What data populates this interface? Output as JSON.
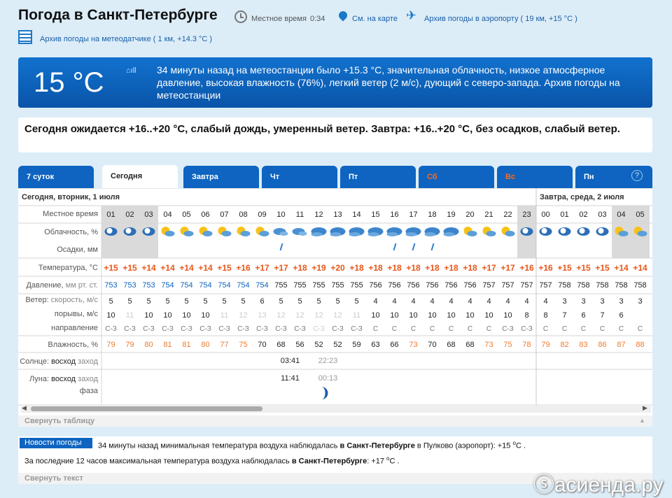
{
  "header": {
    "title": "Погода в Санкт-Петербурге",
    "local_time_label": "Местное время",
    "local_time": "0:34",
    "map_link": "См. на карте",
    "airport_link": "Архив погоды в аэропорту ( 19 км, +15 °C )",
    "station_link": "Архив погоды на метеодатчике ( 1 км, +14.3 °C )"
  },
  "now": {
    "temp": "15 °C",
    "text": "34 минуты назад на метеостанции было +15.3 °C, значительная облачность, низкое атмосферное давление, высокая влажность (76%), легкий ветер (2 м/с), дующий с северо-запада. Архив погоды на метеостанции"
  },
  "forecast": {
    "text": "Сегодня ожидается +16..+20 °C, слабый дождь, умеренный ветер. Завтра: +16..+20 °C, без осадков, слабый ветер."
  },
  "tabs": [
    {
      "label": "7 суток",
      "weekend": false,
      "active": false
    },
    {
      "label": "Сегодня",
      "weekend": false,
      "active": true
    },
    {
      "label": "Завтра",
      "weekend": false,
      "active": false
    },
    {
      "label": "Чт",
      "weekend": false,
      "active": false
    },
    {
      "label": "Пт",
      "weekend": false,
      "active": false
    },
    {
      "label": "Сб",
      "weekend": true,
      "active": false
    },
    {
      "label": "Вс",
      "weekend": true,
      "active": false
    },
    {
      "label": "Пн",
      "weekend": false,
      "active": false
    }
  ],
  "help": "?",
  "table": {
    "day1": "Сегодня, вторник, 1 июля",
    "day2": "Завтра, среда, 2 июля",
    "labels": {
      "time": "Местное время",
      "cloud": "Облачность, %",
      "precip": "Осадки, мм",
      "temp_a": "Температура, ",
      "temp_b": "°C",
      "pres_a": "Давление, ",
      "pres_b": "мм рт. ст.",
      "wind_a": "Ветер: ",
      "wind_b": "скорость, м/с",
      "gust": "порывы, м/с",
      "dir": "направление",
      "hum": "Влажность, %",
      "sun_a": "Солнце: ",
      "sun_b": "восход",
      "sun_c": " заход",
      "moon_a": "Луна: ",
      "moon_b": "восход",
      "moon_c": " заход",
      "phase": "фаза"
    },
    "hours": [
      "01",
      "02",
      "03",
      "04",
      "05",
      "06",
      "07",
      "08",
      "09",
      "10",
      "11",
      "12",
      "13",
      "14",
      "15",
      "16",
      "17",
      "18",
      "19",
      "20",
      "21",
      "22",
      "23",
      "00",
      "01",
      "02",
      "03",
      "04",
      "05"
    ],
    "temps": [
      "+15",
      "+15",
      "+14",
      "+14",
      "+14",
      "+14",
      "+15",
      "+16",
      "+17",
      "+17",
      "+18",
      "+19",
      "+20",
      "+18",
      "+18",
      "+18",
      "+18",
      "+18",
      "+18",
      "+18",
      "+17",
      "+17",
      "+16",
      "+16",
      "+15",
      "+15",
      "+15",
      "+14",
      "+14"
    ],
    "pressure": [
      "753",
      "753",
      "753",
      "754",
      "754",
      "754",
      "754",
      "754",
      "754",
      "755",
      "755",
      "755",
      "755",
      "755",
      "756",
      "756",
      "756",
      "756",
      "756",
      "756",
      "757",
      "757",
      "757",
      "757",
      "758",
      "758",
      "758",
      "758",
      "758"
    ],
    "wind": [
      "5",
      "5",
      "5",
      "5",
      "5",
      "5",
      "5",
      "5",
      "6",
      "5",
      "5",
      "5",
      "5",
      "5",
      "4",
      "4",
      "4",
      "4",
      "4",
      "4",
      "4",
      "4",
      "4",
      "4",
      "3",
      "3",
      "3",
      "3",
      "3"
    ],
    "gusts": [
      "10",
      "11",
      "10",
      "10",
      "10",
      "10",
      "11",
      "12",
      "13",
      "12",
      "12",
      "12",
      "12",
      "11",
      "10",
      "10",
      "10",
      "10",
      "10",
      "10",
      "10",
      "10",
      "8",
      "8",
      "7",
      "6",
      "7",
      "6",
      ""
    ],
    "gust_dim": [
      false,
      true,
      false,
      false,
      false,
      false,
      true,
      true,
      true,
      true,
      true,
      true,
      true,
      true,
      false,
      false,
      false,
      false,
      false,
      false,
      false,
      false,
      false,
      false,
      false,
      false,
      false,
      false,
      false
    ],
    "dirs": [
      "С-З",
      "С-З",
      "С-З",
      "С-З",
      "С-З",
      "С-З",
      "С-З",
      "С-З",
      "С-З",
      "С-З",
      "С-З",
      "С-З",
      "С-З",
      "С-З",
      "С",
      "С",
      "С",
      "С",
      "С",
      "С",
      "С",
      "С-З",
      "С-З",
      "С",
      "С",
      "С",
      "С",
      "С",
      "С"
    ],
    "dir_dim": [
      false,
      false,
      false,
      false,
      false,
      false,
      false,
      false,
      false,
      false,
      false,
      true,
      false,
      false,
      false,
      false,
      false,
      false,
      false,
      false,
      false,
      false,
      false,
      false,
      false,
      false,
      false,
      false,
      false
    ],
    "humidity": [
      "79",
      "79",
      "80",
      "81",
      "81",
      "80",
      "77",
      "75",
      "70",
      "68",
      "56",
      "52",
      "52",
      "59",
      "63",
      "66",
      "73",
      "70",
      "68",
      "68",
      "73",
      "75",
      "78",
      "79",
      "82",
      "83",
      "86",
      "87",
      "88"
    ],
    "hum_orange": [
      true,
      true,
      true,
      true,
      true,
      true,
      true,
      true,
      false,
      false,
      false,
      false,
      false,
      false,
      false,
      false,
      true,
      false,
      false,
      false,
      true,
      true,
      true,
      true,
      true,
      true,
      true,
      true,
      true
    ],
    "cloud_icons": [
      "night-cloudy-icon",
      "night-cloudy-icon",
      "night-cloudy-icon",
      "sun-cloud-icon",
      "sun-cloud-icon",
      "sun-cloud-icon",
      "sun-cloud-icon",
      "sun-cloud-icon",
      "sun-cloud-icon",
      "cloudy-icon",
      "cloudy-icon",
      "overcast-icon",
      "overcast-icon",
      "overcast-icon",
      "overcast-icon",
      "overcast-icon",
      "overcast-icon",
      "overcast-icon",
      "overcast-icon",
      "sun-cloud-icon",
      "sun-cloud-icon",
      "sun-cloud-icon",
      "night-cloudy-icon",
      "night-cloudy-icon",
      "night-cloudy-icon",
      "night-cloudy-icon",
      "night-cloudy-icon",
      "sun-cloud-icon",
      "sun-cloud-icon"
    ],
    "rain": [
      false,
      false,
      false,
      false,
      false,
      false,
      false,
      false,
      false,
      true,
      false,
      false,
      false,
      false,
      false,
      true,
      true,
      true,
      false,
      false,
      false,
      false,
      false,
      false,
      false,
      false,
      false,
      false,
      false
    ],
    "sunrise": "03:41",
    "sunset": "22:23",
    "moonrise": "11:41",
    "moonset": "00:13",
    "collapse": "Свернуть таблицу"
  },
  "news": {
    "badge": "Новости погоды",
    "line1_a": "34 минуты назад минимальная температура воздуха наблюдалась ",
    "line1_b": "в Санкт-Петербурге",
    "line1_c": " в Пулково (аэропорт): +15 ",
    "line1_d": "С .",
    "line2_a": "За последние 12 часов максимальная температура воздуха наблюдалась ",
    "line2_b": "в Санкт-Петербурге",
    "line2_c": ": +17 ",
    "line2_d": "С .",
    "collapse": "Свернуть текст"
  },
  "watermark": "асиенда.ру",
  "colors": {
    "accent": "#0e64c0",
    "temp": "#e8561a",
    "humidity_high": "#ee7c2e",
    "night_col": "#dadada"
  }
}
